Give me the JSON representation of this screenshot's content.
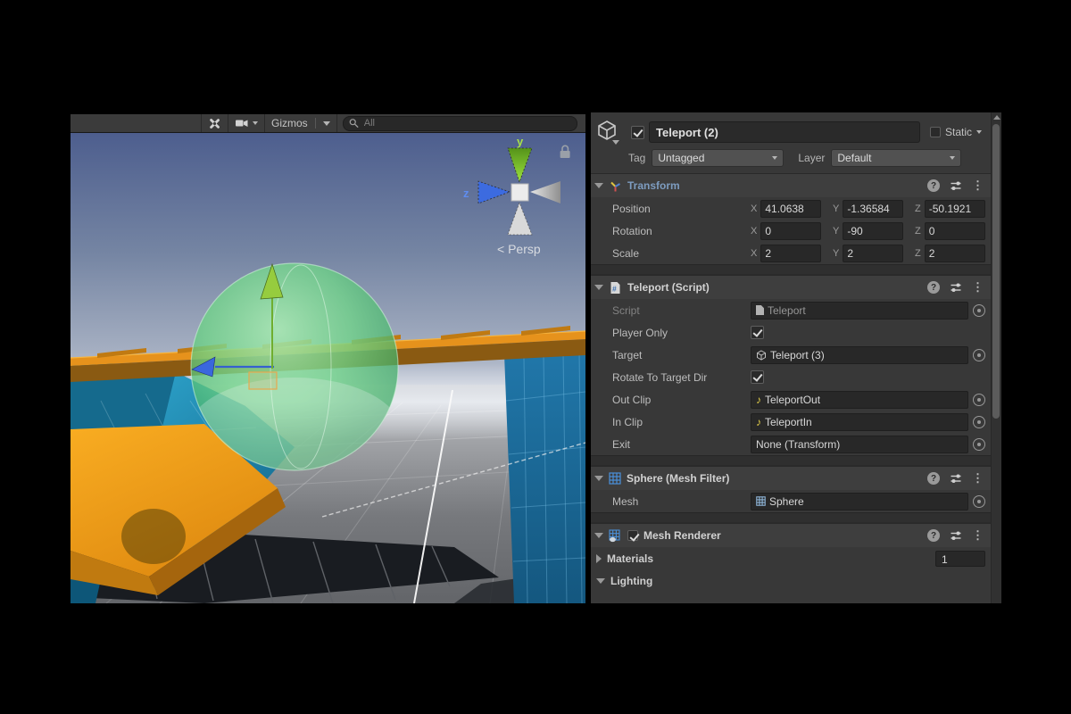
{
  "scene_view": {
    "toolbar": {
      "gizmos_label": "Gizmos",
      "search_placeholder": "All"
    },
    "orientation_gizmo": {
      "y_axis_label": "y",
      "z_axis_label": "z",
      "projection_label": "< Persp"
    }
  },
  "inspector": {
    "header": {
      "name": "Teleport (2)",
      "static_label": "Static",
      "tag_label": "Tag",
      "tag_value": "Untagged",
      "layer_label": "Layer",
      "layer_value": "Default"
    },
    "transform": {
      "title": "Transform",
      "position_label": "Position",
      "rotation_label": "Rotation",
      "scale_label": "Scale",
      "axis_x": "X",
      "axis_y": "Y",
      "axis_z": "Z",
      "position": {
        "x": "41.0638",
        "y": "-1.36584",
        "z": "-50.1921"
      },
      "rotation": {
        "x": "0",
        "y": "-90",
        "z": "0"
      },
      "scale": {
        "x": "2",
        "y": "2",
        "z": "2"
      }
    },
    "teleport_script": {
      "title": "Teleport (Script)",
      "script_label": "Script",
      "script_value": "Teleport",
      "player_only_label": "Player Only",
      "target_label": "Target",
      "target_value": "Teleport (3)",
      "rotate_label": "Rotate To Target Dir",
      "out_clip_label": "Out Clip",
      "out_clip_value": "TeleportOut",
      "in_clip_label": "In Clip",
      "in_clip_value": "TeleportIn",
      "exit_label": "Exit",
      "exit_value": "None (Transform)"
    },
    "mesh_filter": {
      "title": "Sphere (Mesh Filter)",
      "mesh_label": "Mesh",
      "mesh_value": "Sphere"
    },
    "mesh_renderer": {
      "title": "Mesh Renderer",
      "materials_label": "Materials",
      "materials_size": "1",
      "lighting_label": "Lighting"
    }
  },
  "colors": {
    "transform_title": "#7d9cc0",
    "audio_icon": "#e3cf4a",
    "mesh_icon": "#4a90d9",
    "sphere_green": "#4fbf7a",
    "platform_orange": "#e8931d",
    "wall_teal": "#2695bd",
    "wall_blue": "#1e74a6"
  }
}
